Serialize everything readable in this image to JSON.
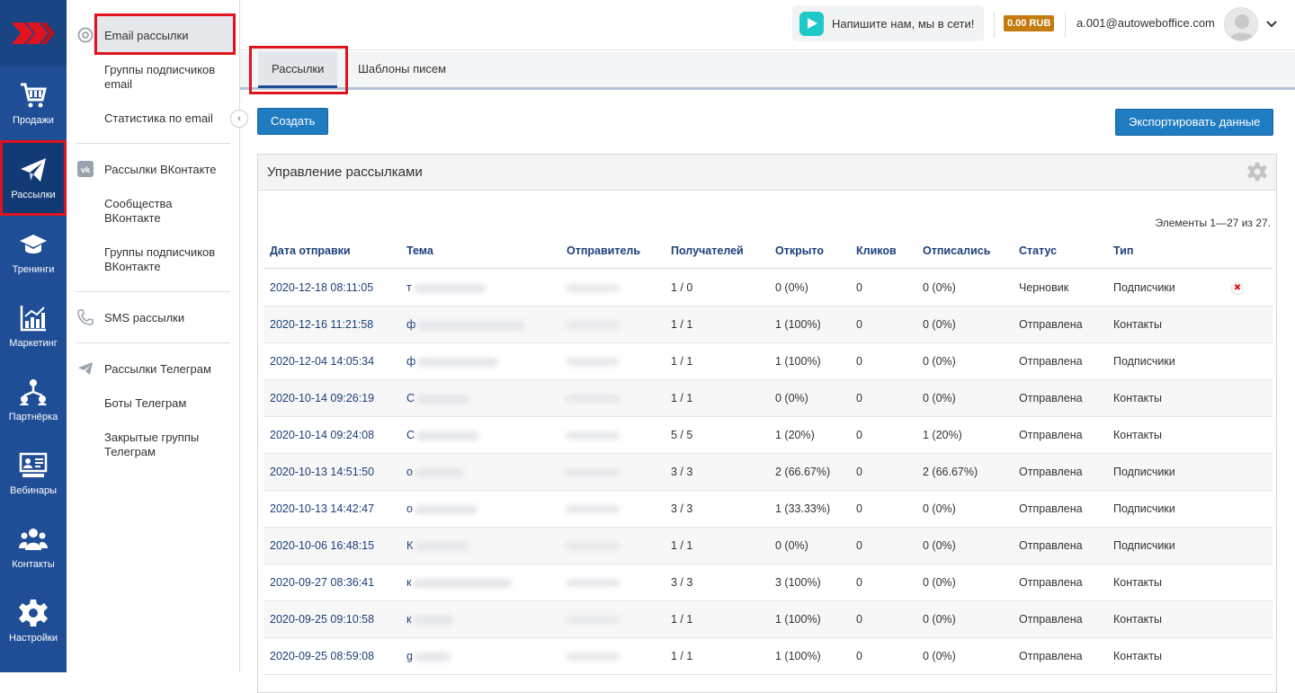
{
  "nav": {
    "items": [
      {
        "label": "Продажи",
        "icon": "cart-icon"
      },
      {
        "label": "Рассылки",
        "icon": "paper-plane-icon"
      },
      {
        "label": "Тренинги",
        "icon": "graduation-cap-icon"
      },
      {
        "label": "Маркетинг",
        "icon": "bar-chart-icon"
      },
      {
        "label": "Партнёрка",
        "icon": "network-icon"
      },
      {
        "label": "Вебинары",
        "icon": "presentation-icon"
      },
      {
        "label": "Контакты",
        "icon": "people-icon"
      },
      {
        "label": "Настройки",
        "icon": "gear-icon"
      }
    ]
  },
  "submenu": {
    "email": "Email рассылки",
    "email_groups": "Группы подписчиков email",
    "email_stats": "Статистика по email",
    "vk": "Рассылки ВКонтакте",
    "vk_communities": "Сообщества ВКонтакте",
    "vk_groups": "Группы подписчиков ВКонтакте",
    "sms": "SMS рассылки",
    "telegram": "Рассылки Телеграм",
    "telegram_bots": "Боты Телеграм",
    "telegram_groups": "Закрытые группы Телеграм"
  },
  "topbar": {
    "chat_text": "Напишите нам, мы в сети!",
    "balance": "0.00 RUB",
    "email": "a.001@autoweboffice.com"
  },
  "tabs": [
    "Рассылки",
    "Шаблоны писем"
  ],
  "actions": {
    "create": "Создать",
    "export": "Экспортировать данные"
  },
  "panel": {
    "title": "Управление рассылками",
    "summary": "Элементы 1—27 из 27."
  },
  "table": {
    "headers": [
      "Дата отправки",
      "Тема",
      "Отправитель",
      "Получателей",
      "Открыто",
      "Кликов",
      "Отписались",
      "Статус",
      "Тип"
    ],
    "rows": [
      {
        "date": "2020-12-18 08:11:05",
        "topic": "т",
        "recipients": "1 / 0",
        "opened": "0 (0%)",
        "clicks": "0",
        "unsub": "0 (0%)",
        "status": "Черновик",
        "type": "Подписчики",
        "deletable": true
      },
      {
        "date": "2020-12-16 11:21:58",
        "topic": "ф",
        "recipients": "1 / 1",
        "opened": "1 (100%)",
        "clicks": "0",
        "unsub": "0 (0%)",
        "status": "Отправлена",
        "type": "Контакты"
      },
      {
        "date": "2020-12-04 14:05:34",
        "topic": "ф",
        "recipients": "1 / 1",
        "opened": "1 (100%)",
        "clicks": "0",
        "unsub": "0 (0%)",
        "status": "Отправлена",
        "type": "Подписчики"
      },
      {
        "date": "2020-10-14 09:26:19",
        "topic": "С",
        "recipients": "1 / 1",
        "opened": "0 (0%)",
        "clicks": "0",
        "unsub": "0 (0%)",
        "status": "Отправлена",
        "type": "Контакты"
      },
      {
        "date": "2020-10-14 09:24:08",
        "topic": "С",
        "recipients": "5 / 5",
        "opened": "1 (20%)",
        "clicks": "0",
        "unsub": "1 (20%)",
        "status": "Отправлена",
        "type": "Контакты"
      },
      {
        "date": "2020-10-13 14:51:50",
        "topic": "о",
        "recipients": "3 / 3",
        "opened": "2 (66.67%)",
        "clicks": "0",
        "unsub": "2 (66.67%)",
        "status": "Отправлена",
        "type": "Подписчики"
      },
      {
        "date": "2020-10-13 14:42:47",
        "topic": "о",
        "recipients": "3 / 3",
        "opened": "1 (33.33%)",
        "clicks": "0",
        "unsub": "0 (0%)",
        "status": "Отправлена",
        "type": "Подписчики"
      },
      {
        "date": "2020-10-06 16:48:15",
        "topic": "К",
        "recipients": "1 / 1",
        "opened": "0 (0%)",
        "clicks": "0",
        "unsub": "0 (0%)",
        "status": "Отправлена",
        "type": "Подписчики"
      },
      {
        "date": "2020-09-27 08:36:41",
        "topic": "к",
        "recipients": "3 / 3",
        "opened": "3 (100%)",
        "clicks": "0",
        "unsub": "0 (0%)",
        "status": "Отправлена",
        "type": "Контакты"
      },
      {
        "date": "2020-09-25 09:10:58",
        "topic": "к",
        "recipients": "1 / 1",
        "opened": "1 (100%)",
        "clicks": "0",
        "unsub": "0 (0%)",
        "status": "Отправлена",
        "type": "Контакты"
      },
      {
        "date": "2020-09-25 08:59:08",
        "topic": "g",
        "recipients": "1 / 1",
        "opened": "1 (100%)",
        "clicks": "0",
        "unsub": "0 (0%)",
        "status": "Отправлена",
        "type": "Контакты"
      }
    ]
  },
  "colors": {
    "rail": "#1f4e96",
    "accent_button": "#1f7cc1",
    "highlight": "#e0141e",
    "balance_badge": "#c47b10",
    "link": "#1c3f7a"
  }
}
